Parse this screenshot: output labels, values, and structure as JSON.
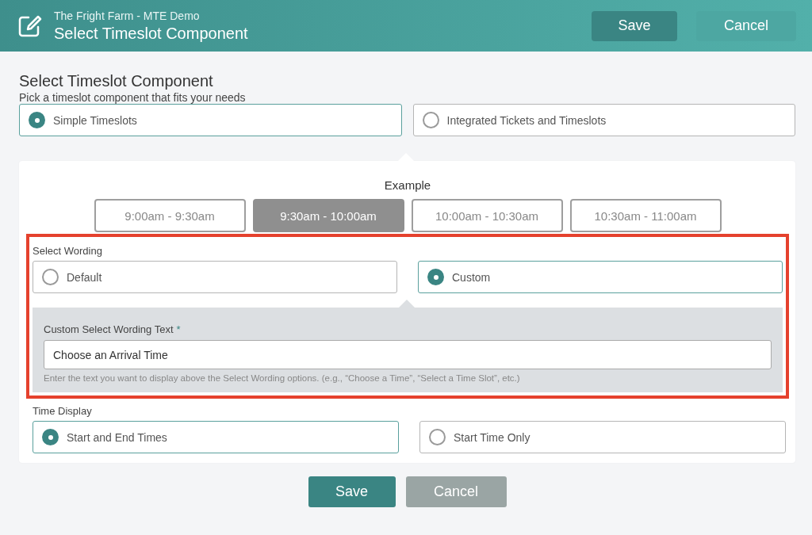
{
  "header": {
    "subtitle": "The Fright Farm - MTE Demo",
    "title": "Select Timeslot Component"
  },
  "header_buttons": [
    {
      "label": "Save",
      "kind": "primary"
    },
    {
      "label": "Cancel",
      "kind": "secondary"
    }
  ],
  "section": {
    "title": "Select Timeslot Component",
    "subtitle": "Pick a timeslot component that fits your needs"
  },
  "component_options": [
    {
      "label": "Simple Timeslots",
      "selected": true
    },
    {
      "label": "Integrated Tickets and Timeslots",
      "selected": false
    }
  ],
  "example": {
    "label": "Example",
    "timeslots": [
      {
        "label": "9:00am - 9:30am",
        "selected": false
      },
      {
        "label": "9:30am - 10:00am",
        "selected": true
      },
      {
        "label": "10:00am - 10:30am",
        "selected": false
      },
      {
        "label": "10:30am - 11:00am",
        "selected": false
      }
    ]
  },
  "select_wording": {
    "label": "Select Wording",
    "options": [
      {
        "label": "Default",
        "selected": false
      },
      {
        "label": "Custom",
        "selected": true
      }
    ],
    "custom_text": {
      "label": "Custom Select Wording Text",
      "required_mark": "*",
      "value": "Choose an Arrival Time",
      "help": "Enter the text you want to display above the Select Wording options. (e.g., “Choose a Time”, “Select a Time Slot”, etc.)"
    }
  },
  "time_display": {
    "label": "Time Display",
    "options": [
      {
        "label": "Start and End Times",
        "selected": true
      },
      {
        "label": "Start Time Only",
        "selected": false
      }
    ]
  },
  "footer_buttons": [
    {
      "label": "Save",
      "kind": "primary"
    },
    {
      "label": "Cancel",
      "kind": "secondary"
    }
  ]
}
